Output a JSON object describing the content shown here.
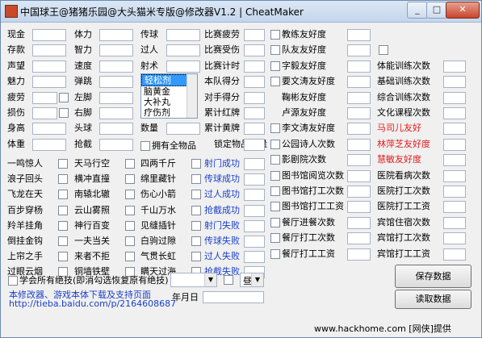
{
  "window": {
    "title": "中国球王@猪猪乐园@大头猫米专版@修改器V1.2 | CheatMaker",
    "min": "_",
    "max": "□",
    "close": "✕"
  },
  "col1": [
    "现金",
    "存款",
    "声望",
    "魅力",
    "疲劳",
    "损伤",
    "身高",
    "体重"
  ],
  "col2": [
    "体力",
    "智力",
    "速度",
    "弹跳",
    "左脚",
    "右脚",
    "头球",
    "抢截"
  ],
  "col3": [
    "传球",
    "过人",
    "射术"
  ],
  "col3_lower": [
    "数量"
  ],
  "col4": [
    "比赛疲劳",
    "比赛受伤",
    "比赛计时",
    "本队得分",
    "对手得分",
    "累计红牌",
    "累计黄牌",
    "锁定物品数量"
  ],
  "col5": [
    "教练友好度",
    "队友友好度",
    "字毅友好度",
    "要文涛友好度",
    "鞠彬友好度",
    "卢源友好度",
    "李文涛友好度",
    "公园诗人次数",
    "影剧院次数",
    "图书馆阅览次数",
    "图书馆打工次数",
    "图书馆打工工资",
    "餐厅进餐次数",
    "餐厅打工次数",
    "餐厅打工工资"
  ],
  "col6": [
    "体能训练次数",
    "基础训练次数",
    "综合训练次数",
    "文化课程次数",
    "马司儿友好",
    "林萍芝友好度",
    "慧敏友好度",
    "医院看病次数",
    "医院打工次数",
    "医院打工工资",
    "宾馆住宿次数",
    "宾馆打工次数",
    "宾馆打工工资"
  ],
  "skills_a": [
    "一鸣惊人",
    "浪子回头",
    "飞龙在天",
    "百步穿杨",
    "羚羊挂角",
    "倒挂金钩",
    "上帘之手",
    "过眼云烟"
  ],
  "skills_b": [
    "天马行空",
    "横冲直撞",
    "南辕北辙",
    "云山雾照",
    "神行百变",
    "一夫当关",
    "来者不拒",
    "铜墙铁壁"
  ],
  "skills_c": [
    "四两千斤",
    "绵里藏针",
    "伤心小箭",
    "千山万水",
    "见缝插针",
    "白驹过隙",
    "气贯长虹",
    "瞒天过海"
  ],
  "skills_d": [
    "射门成功",
    "传球成功",
    "过人成功",
    "抢截成功",
    "射门失败",
    "传球失败",
    "过人失败",
    "抢截失败"
  ],
  "item_list": [
    "轻松剂",
    "脑黄金",
    "大补丸",
    "疗伤剂"
  ],
  "all_items_label": "拥有全物品",
  "learn_all_label": "学会所有绝技(即消勾选恢复原有绝技)",
  "date_label": "年月日",
  "combo_value": "昼",
  "save_label": "保存数据",
  "load_label": "读取数据",
  "footer_line1": "本修改器、游戏本体下载及支持页面",
  "footer_line2": "http://tieba.baidu.com/p/2164608687",
  "watermark": "www.hackhome.com [网侠]提供",
  "colors": {
    "accent_blue": "#1a3fc8",
    "accent_red": "#e01a1a",
    "selection": "#3399ff"
  }
}
